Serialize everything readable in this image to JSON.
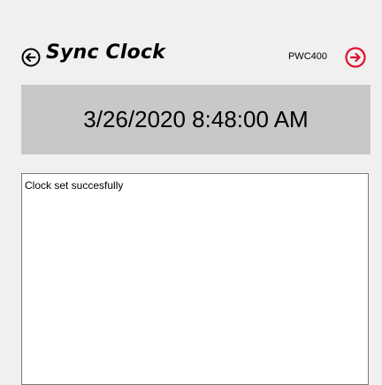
{
  "header": {
    "title": "Sync Clock",
    "device_label": "PWC400",
    "back_icon": "circle-arrow-left-icon",
    "next_icon": "circle-arrow-right-icon"
  },
  "clock": {
    "datetime": "3/26/2020 8:48:00 AM"
  },
  "log": {
    "lines": [
      "Clock set succesfully"
    ]
  },
  "colors": {
    "background": "#f0f0f0",
    "datetime_bar": "#c8c8c8",
    "next_accent": "#e0102a",
    "back_icon": "#000000"
  }
}
